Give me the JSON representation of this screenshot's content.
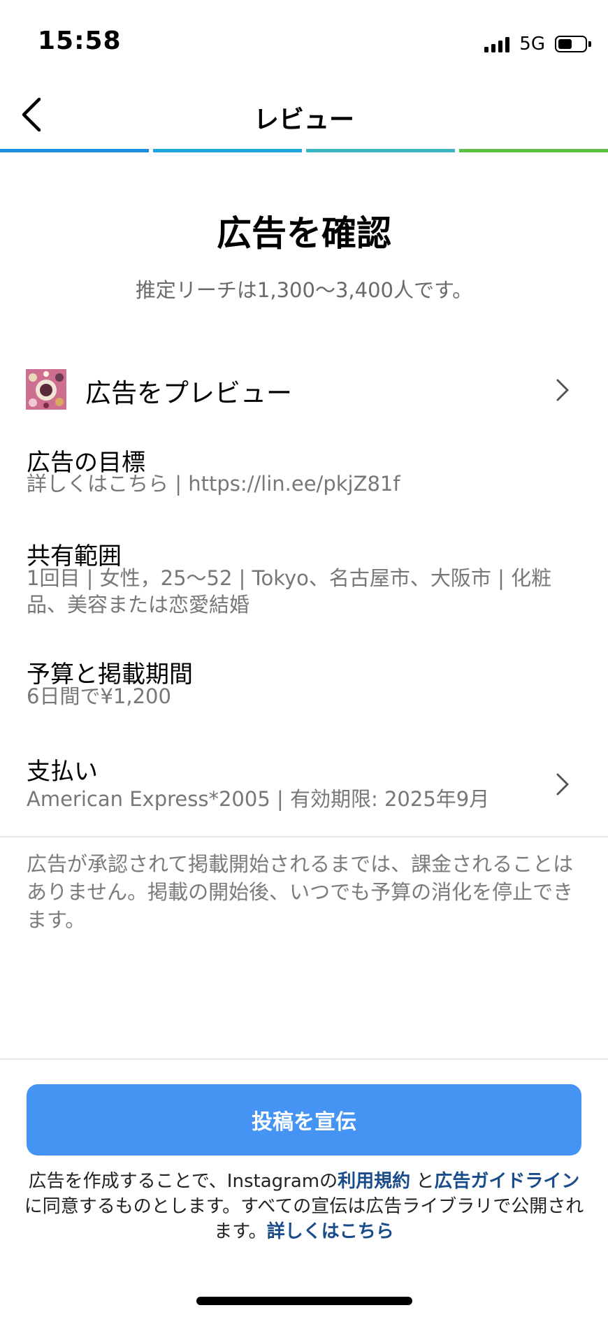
{
  "status_bar": {
    "time": "15:58",
    "network": "5G",
    "battery_level": 0.56
  },
  "header": {
    "title": "レビュー"
  },
  "progress": {
    "colors": [
      "#1c8ee2",
      "#1ca6e0",
      "#3ab7c3",
      "#5cc042"
    ]
  },
  "main": {
    "title": "広告を確認",
    "subtitle": "推定リーチは1,300〜3,400人です。",
    "preview": {
      "label": "広告をプレビュー"
    },
    "objective": {
      "title": "広告の目標",
      "value": "詳しくはこちら | https://lin.ee/pkjZ81f"
    },
    "audience": {
      "title": "共有範囲",
      "value": "1回目 | 女性，25〜52 | Tokyo、名古屋市、大阪市 | 化粧品、美容または恋愛結婚"
    },
    "budget": {
      "title": "予算と掲載期間",
      "value": "6日間で¥1,200"
    },
    "payment": {
      "title": "支払い",
      "value": "American Express*2005 | 有効期限: 2025年9月"
    },
    "notice": "広告が承認されて掲載開始されるまでは、課金されることはありません。掲載の開始後、いつでも予算の消化を停止できます。"
  },
  "footer": {
    "promote_button": "投稿を宣伝",
    "legal_prefix": "広告を作成することで、Instagramの",
    "terms_link": "利用規約",
    "legal_and": " と",
    "guidelines_link": "広告ガイドライン",
    "legal_suffix": "に同意するものとします。すべての宣伝は広告ライブラリで公開されます。",
    "learn_more_link": "詳しくはこちら"
  }
}
